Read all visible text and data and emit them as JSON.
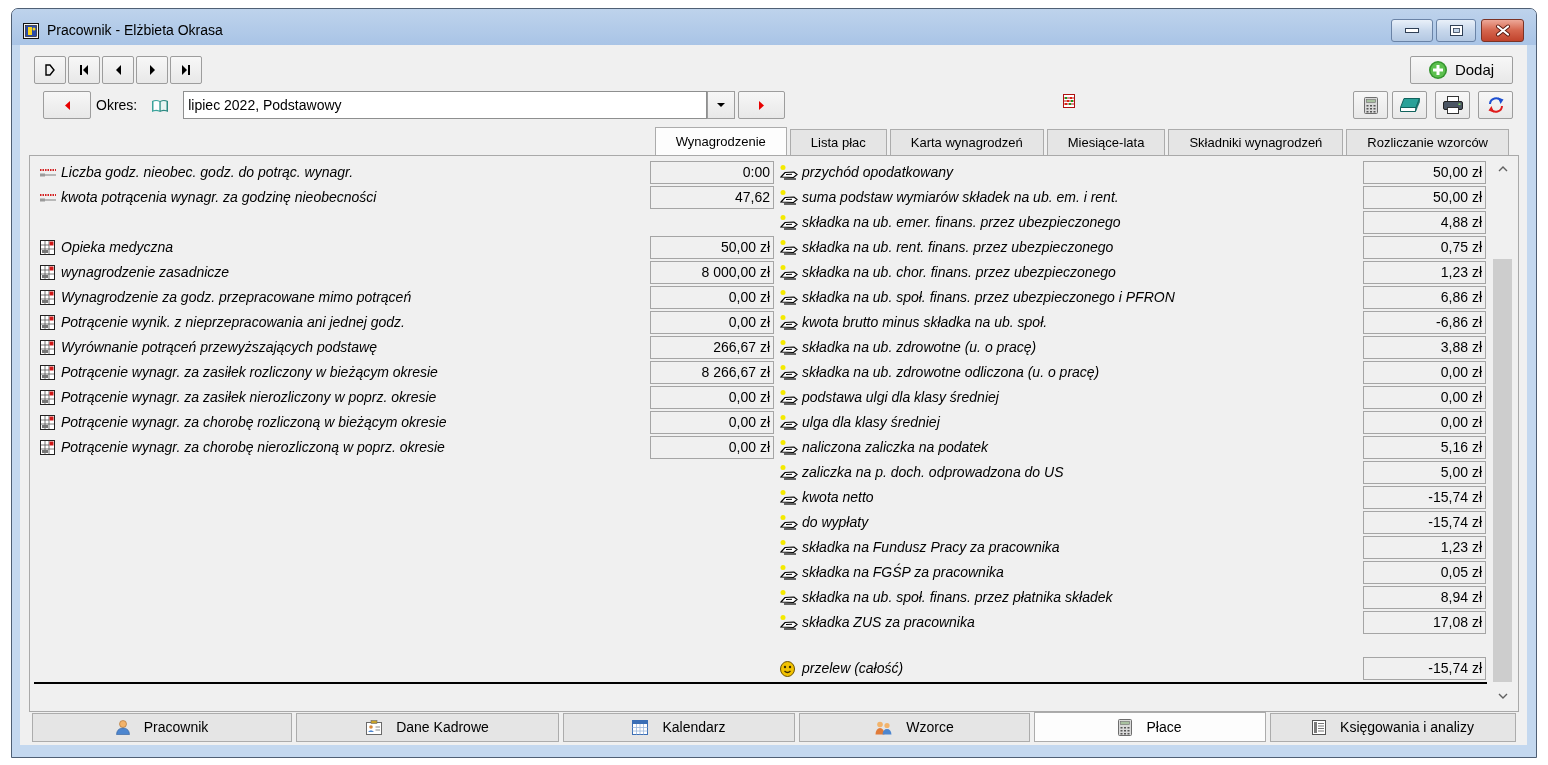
{
  "window": {
    "title": "Pracownik - Elżbieta Okrasa"
  },
  "toolbar": {
    "add_label": "Dodaj"
  },
  "period": {
    "label": "Okres:",
    "value": "lipiec 2022, Podstawowy"
  },
  "tabs": [
    {
      "label": "Wynagrodzenie",
      "selected": true
    },
    {
      "label": "Lista płac",
      "selected": false
    },
    {
      "label": "Karta wynagrodzeń",
      "selected": false
    },
    {
      "label": "Miesiące-lata",
      "selected": false
    },
    {
      "label": "Składniki wynagrodzeń",
      "selected": false
    },
    {
      "label": "Rozliczanie wzorców",
      "selected": false
    }
  ],
  "left_groups": [
    {
      "rows": [
        {
          "kind": "hours",
          "label": "Liczba godz. nieobec. godz. do potrąc. wynagr.",
          "value": "0:00"
        },
        {
          "kind": "hours",
          "label": "kwota potrącenia wynagr. za godzinę nieobecności",
          "value": "47,62"
        }
      ]
    },
    {
      "rows": [
        {
          "kind": "component",
          "label": "Opieka medyczna",
          "value": "50,00 zł"
        },
        {
          "kind": "component",
          "label": "wynagrodzenie zasadnicze",
          "value": "8 000,00 zł"
        },
        {
          "kind": "component",
          "label": "Wynagrodzenie za godz. przepracowane mimo potrąceń",
          "value": "0,00 zł"
        },
        {
          "kind": "component",
          "label": "Potrącenie wynik. z nieprzepracowania ani jednej godz.",
          "value": "0,00 zł"
        },
        {
          "kind": "component",
          "label": "Wyrównanie potrąceń przewyższających podstawę",
          "value": "266,67 zł"
        },
        {
          "kind": "component",
          "label": "Potrącenie wynagr. za zasiłek rozliczony w bieżącym okresie",
          "value": "8 266,67 zł"
        },
        {
          "kind": "component",
          "label": "Potrącenie wynagr. za zasiłek nierozliczony w poprz. okresie",
          "value": "0,00 zł"
        },
        {
          "kind": "component",
          "label": "Potrącenie wynagr. za chorobę rozliczoną w bieżącym okresie",
          "value": "0,00 zł"
        },
        {
          "kind": "component",
          "label": "Potrącenie wynagr. za chorobę nierozliczoną w poprz. okresie",
          "value": "0,00 zł"
        }
      ]
    }
  ],
  "right_groups": [
    {
      "rows": [
        {
          "kind": "entry",
          "label": "przychód opodatkowany",
          "value": "50,00 zł"
        },
        {
          "kind": "entry",
          "label": "suma podstaw wymiarów składek na ub. em. i rent.",
          "value": "50,00 zł"
        },
        {
          "kind": "entry",
          "label": "składka na ub. emer. finans. przez ubezpieczonego",
          "value": "4,88 zł"
        },
        {
          "kind": "entry",
          "label": "składka na ub. rent. finans. przez ubezpieczonego",
          "value": "0,75 zł"
        },
        {
          "kind": "entry",
          "label": "składka na ub. chor. finans. przez ubezpieczonego",
          "value": "1,23 zł"
        },
        {
          "kind": "entry",
          "label": "składka na ub. społ. finans. przez ubezpieczonego i PFRON",
          "value": "6,86 zł"
        },
        {
          "kind": "entry",
          "label": "kwota brutto minus składka na ub. społ.",
          "value": "-6,86 zł"
        },
        {
          "kind": "entry",
          "label": "składka na ub. zdrowotne (u. o pracę)",
          "value": "3,88 zł"
        },
        {
          "kind": "entry",
          "label": "składka na ub. zdrowotne odliczona (u. o pracę)",
          "value": "0,00 zł"
        },
        {
          "kind": "entry",
          "label": "podstawa ulgi dla klasy średniej",
          "value": "0,00 zł"
        },
        {
          "kind": "entry",
          "label": "ulga dla klasy średniej",
          "value": "0,00 zł"
        },
        {
          "kind": "entry",
          "label": "naliczona zaliczka na podatek",
          "value": "5,16 zł"
        },
        {
          "kind": "entry",
          "label": "zaliczka na p. doch. odprowadzona do US",
          "value": "5,00 zł"
        },
        {
          "kind": "entry",
          "label": "kwota netto",
          "value": "-15,74 zł"
        },
        {
          "kind": "entry",
          "label": "do wypłaty",
          "value": "-15,74 zł"
        },
        {
          "kind": "entry",
          "label": "składka na Fundusz Pracy za pracownika",
          "value": "1,23 zł"
        },
        {
          "kind": "entry",
          "label": "składka na FGŚP za pracownika",
          "value": "0,05 zł"
        },
        {
          "kind": "entry",
          "label": "składka na ub. społ. finans. przez płatnika składek",
          "value": "8,94 zł"
        },
        {
          "kind": "entry",
          "label": "składka ZUS za pracownika",
          "value": "17,08 zł"
        }
      ]
    },
    {
      "rows": [
        {
          "kind": "transfer",
          "label": "przelew (całość)",
          "value": "-15,74 zł"
        }
      ]
    }
  ],
  "bottom_tabs": [
    {
      "label": "Pracownik",
      "selected": false
    },
    {
      "label": "Dane Kadrowe",
      "selected": false
    },
    {
      "label": "Kalendarz",
      "selected": false
    },
    {
      "label": "Wzorce",
      "selected": false
    },
    {
      "label": "Płace",
      "selected": true
    },
    {
      "label": "Księgowania i analizy",
      "selected": false
    }
  ]
}
